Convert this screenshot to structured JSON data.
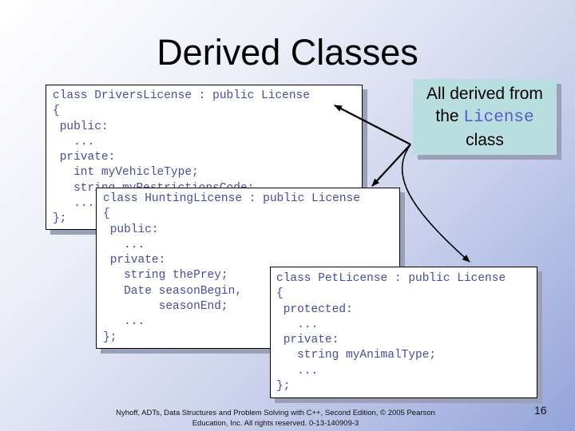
{
  "slide": {
    "title": "Derived Classes",
    "page_number": "16",
    "footer": {
      "line1": "Nyhoff, ADTs, Data Structures and Problem Solving with C++, Second Edition, © 2005 Pearson",
      "line2": "Education, Inc. All rights reserved. 0-13-140909-3"
    }
  },
  "code_boxes": {
    "drivers_license": "class DriversLicense : public License\n{\n public:\n   ...\n private:\n   int myVehicleType;\n   string myRestrictionsCode;\n   ...\n};",
    "hunting_license": "class HuntingLicense : public License\n{\n public:\n   ...\n private:\n   string thePrey;\n   Date seasonBegin,\n        seasonEnd;\n   ...\n};",
    "pet_license": "class PetLicense : public License\n{\n protected:\n   ...\n private:\n   string myAnimalType;\n   ...\n};"
  },
  "callout": {
    "line1": "All derived from",
    "line2_prefix": "the ",
    "line2_code": "License",
    "line3": "class"
  },
  "colors": {
    "code_text": "#4a4aa8",
    "callout_bg": "#b9dee0",
    "callout_code": "#5a5ad0"
  }
}
